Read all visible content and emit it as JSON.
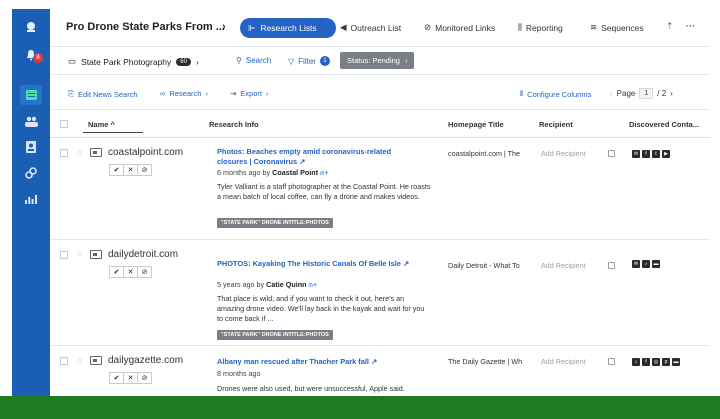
{
  "colors": {
    "sidebar": "#1b5fb5",
    "accent": "#2463c4",
    "chip": "#7a7f87",
    "footer": "#1f7a24",
    "badge": "#e23b3b"
  },
  "sidebar": {
    "notifications_count": "8"
  },
  "header": {
    "project_title": "Pro Drone State Parks From ...",
    "nav": [
      {
        "label": "Research Lists"
      },
      {
        "label": "Outreach List"
      },
      {
        "label": "Monitored Links"
      },
      {
        "label": "Reporting"
      },
      {
        "label": "Sequences"
      }
    ],
    "more": "···"
  },
  "filters": {
    "list_name": "State Park Photography",
    "list_count": "60",
    "search_label": "Search",
    "filter_label": "Filter",
    "filter_count": "1",
    "status_chip": "Status: Pending"
  },
  "actions": {
    "edit_news": "Edit News Search",
    "research": "Research",
    "export": "Export",
    "configure": "Configure Columns",
    "page_label": "Page",
    "page_current": "1",
    "page_total": "/ 2"
  },
  "columns": {
    "name": "Name ^",
    "research_info": "Research Info",
    "homepage_title": "Homepage Title",
    "recipient": "Recipient",
    "discovered": "Discovered Conta..."
  },
  "rows": [
    {
      "domain": "coastalpoint.com",
      "title": "Photos: Beaches empty amid coronavirus-related closures | Coronavirus",
      "meta_prefix": "6 months ago by",
      "author": "Coastal Point",
      "body": "Tyler Valliant is a staff photographer at the Coastal Point. He roasts a mean batch of local coffee, can fly a drone and makes videos.",
      "tag": "\"STATE PARK\" DRONE INTITLE:PHOTOS",
      "homepage": "coastalpoint.com | The",
      "recipient": "Add Recipient"
    },
    {
      "domain": "dailydetroit.com",
      "title": "PHOTOS: Kayaking The Historic Canals Of Belle Isle",
      "meta_prefix": "5 years ago by",
      "author": "Catie Quinn",
      "body": "That place is wild, and if you want to check it out, here's an amazing drone video. We'll lay back in the kayak and wait for you to come back if ...",
      "tag": "\"STATE PARK\" DRONE INTITLE:PHOTOS",
      "homepage": "Daily Detroit - What To",
      "recipient": "Add Recipient"
    },
    {
      "domain": "dailygazette.com",
      "title": "Albany man rescued after Thacher Park fall",
      "meta_prefix": "8 months ago",
      "author": "",
      "body": "Drones were also used, but were unsuccessful, Apple said.",
      "tag": "",
      "homepage": "The Daily Gazette | Wh",
      "recipient": "Add Recipient"
    }
  ]
}
